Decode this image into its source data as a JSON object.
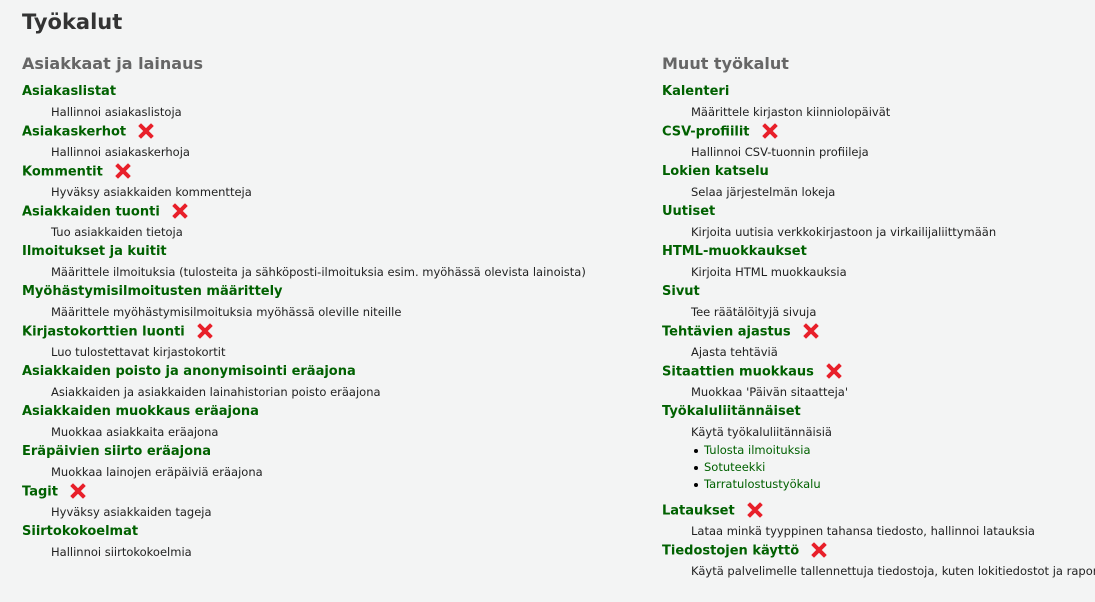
{
  "page_title": "Työkalut",
  "colors": {
    "link": "#006100",
    "heading": "#666666",
    "x_mark": "#e8202a"
  },
  "left": {
    "heading": "Asiakkaat ja lainaus",
    "items": [
      {
        "title": "Asiakaslistat",
        "desc": "Hallinnoi asiakaslistoja",
        "x": false
      },
      {
        "title": "Asiakaskerhot",
        "desc": "Hallinnoi asiakaskerhoja",
        "x": true
      },
      {
        "title": "Kommentit",
        "desc": "Hyväksy asiakkaiden kommentteja",
        "x": true
      },
      {
        "title": "Asiakkaiden tuonti",
        "desc": "Tuo asiakkaiden tietoja",
        "x": true
      },
      {
        "title": "Ilmoitukset ja kuitit",
        "desc": "Määrittele ilmoituksia (tulosteita ja sähköposti-ilmoituksia esim. myöhässä olevista lainoista)",
        "x": false
      },
      {
        "title": "Myöhästymisilmoitusten määrittely",
        "desc": "Määrittele myöhästymisilmoituksia myöhässä oleville niteille",
        "x": false
      },
      {
        "title": "Kirjastokorttien luonti",
        "desc": "Luo tulostettavat kirjastokortit",
        "x": true
      },
      {
        "title": "Asiakkaiden poisto ja anonymisointi eräajona",
        "desc": "Asiakkaiden ja asiakkaiden lainahistorian poisto eräajona",
        "x": false
      },
      {
        "title": "Asiakkaiden muokkaus eräajona",
        "desc": "Muokkaa asiakkaita eräajona",
        "x": false
      },
      {
        "title": "Eräpäivien siirto eräajona",
        "desc": "Muokkaa lainojen eräpäiviä eräajona",
        "x": false
      },
      {
        "title": "Tagit",
        "desc": "Hyväksy asiakkaiden tageja",
        "x": true
      },
      {
        "title": "Siirtokokoelmat",
        "desc": "Hallinnoi siirtokokoelmia",
        "x": false
      }
    ]
  },
  "right": {
    "heading": "Muut työkalut",
    "items": [
      {
        "title": "Kalenteri",
        "desc": "Määrittele kirjaston kiinniolopäivät",
        "x": false
      },
      {
        "title": "CSV-profiilit",
        "desc": "Hallinnoi CSV-tuonnin profiileja",
        "x": true
      },
      {
        "title": "Lokien katselu",
        "desc": "Selaa järjestelmän lokeja",
        "x": false
      },
      {
        "title": "Uutiset",
        "desc": "Kirjoita uutisia verkkokirjastoon ja virkailijaliittymään",
        "x": false
      },
      {
        "title": "HTML-muokkaukset",
        "desc": "Kirjoita HTML muokkauksia",
        "x": false
      },
      {
        "title": "Sivut",
        "desc": "Tee räätälöityjä sivuja",
        "x": false
      },
      {
        "title": "Tehtävien ajastus",
        "desc": "Ajasta tehtäviä",
        "x": true
      },
      {
        "title": "Sitaattien muokkaus",
        "desc": "Muokkaa 'Päivän sitaatteja'",
        "x": true
      },
      {
        "title": "Työkaluliitännäiset",
        "desc": "Käytä työkaluliitännäisiä",
        "x": false,
        "plugins": [
          "Tulosta ilmoituksia",
          "Sotuteekki",
          "Tarratulostustyökalu"
        ]
      },
      {
        "title": "Lataukset",
        "desc": "Lataa minkä tyyppinen tahansa tiedosto, hallinnoi latauksia",
        "x": true
      },
      {
        "title": "Tiedostojen käyttö",
        "desc": "Käytä palvelimelle tallennettuja tiedostoja, kuten lokitiedostot ja raportit",
        "x": true
      }
    ]
  }
}
